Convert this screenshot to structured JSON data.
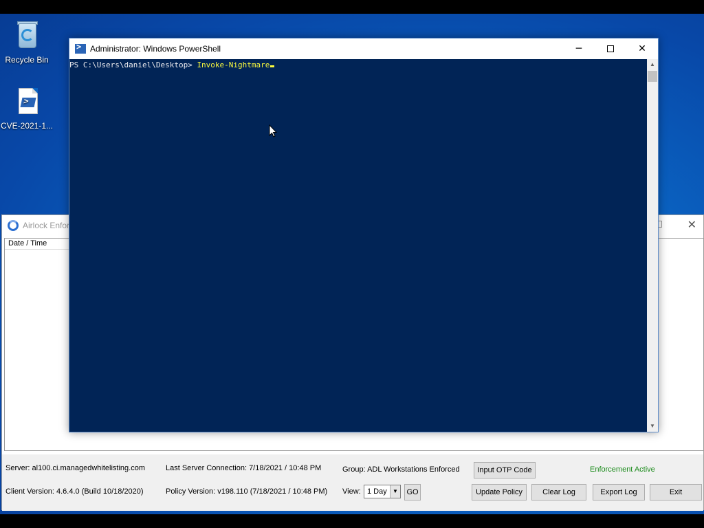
{
  "desktop": {
    "icons": [
      {
        "label": "Recycle Bin",
        "icon": "recycle-bin-icon"
      },
      {
        "label": "CVE-2021-1...",
        "icon": "powershell-script-icon"
      }
    ]
  },
  "powershell": {
    "title": "Administrator: Windows PowerShell",
    "prompt": "PS C:\\Users\\daniel\\Desktop> ",
    "command": "Invoke-Nightmare",
    "colors": {
      "background": "#012456",
      "command": "#fcfb3d",
      "text": "#eeedf0"
    }
  },
  "airlock": {
    "title": "Airlock Enfor",
    "log_column": "Date / Time",
    "server": "Server: al100.ci.managedwhitelisting.com",
    "client_version": "Client Version: 4.6.4.0 (Build 10/18/2020)",
    "last_connection": "Last Server Connection: 7/18/2021 / 10:48 PM",
    "policy_version": "Policy Version: v198.110 (7/18/2021 / 10:48 PM)",
    "group": "Group: ADL Workstations Enforced",
    "view_label": "View:",
    "view_value": "1 Day",
    "go_button": "GO",
    "otp_button": "Input OTP Code",
    "update_button": "Update Policy",
    "clear_button": "Clear Log",
    "export_button": "Export Log",
    "exit_button": "Exit",
    "status": "Enforcement Active",
    "status_color": "#1a8a1a"
  }
}
